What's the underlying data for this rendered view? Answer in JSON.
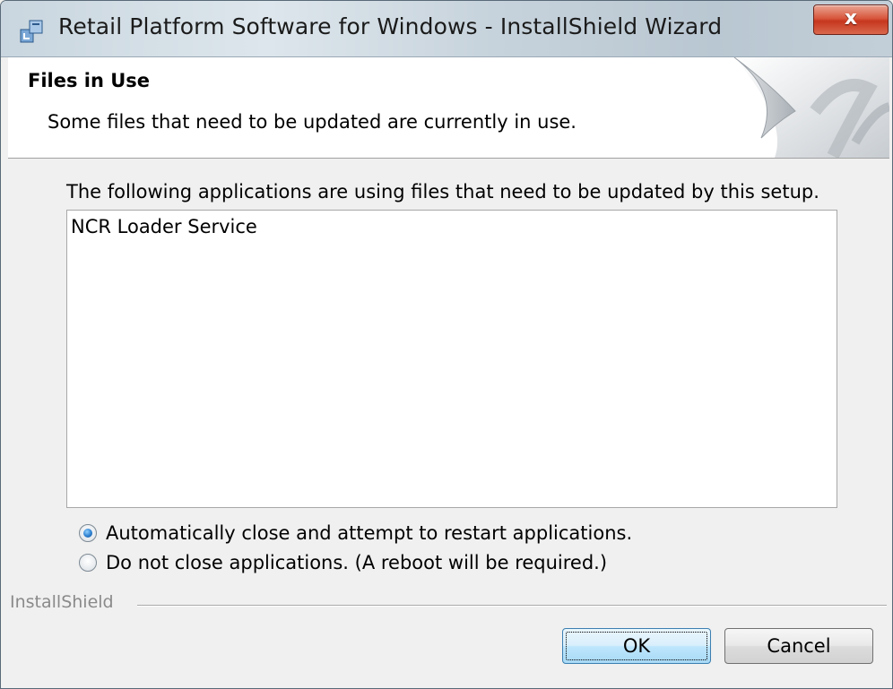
{
  "window": {
    "title": "Retail Platform Software for Windows - InstallShield Wizard",
    "close_glyph": "x"
  },
  "banner": {
    "title": "Files in Use",
    "subtitle": "Some files that need to be updated are currently in use."
  },
  "main": {
    "description": "The following applications are using files that need to be updated by this setup.",
    "applications": [
      "NCR Loader Service"
    ],
    "options": [
      {
        "label": "Automatically close and attempt to restart applications.",
        "selected": true
      },
      {
        "label": "Do not close applications. (A reboot will be required.)",
        "selected": false
      }
    ]
  },
  "footer": {
    "brand": "InstallShield",
    "ok_label": "OK",
    "cancel_label": "Cancel"
  },
  "colors": {
    "banner_bg": "#ffffff",
    "dialog_bg": "#f0f0f0",
    "close_button": "#c6361e",
    "default_button_border": "#3c7fb1"
  },
  "icons": {
    "title_icon": "installer-icon",
    "banner_art": "page-curl-icon"
  }
}
